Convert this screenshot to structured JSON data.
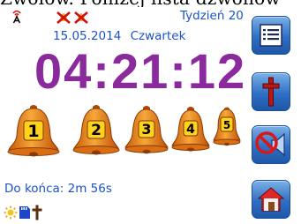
{
  "top_caption": "Zwołów. Poniżej lista dzwonów",
  "status": {
    "antenna_icon": "antenna-icon",
    "muted_indicators": [
      "muted-bell-icon",
      "muted-bell-icon"
    ],
    "week": "Tydzień 20",
    "date": "15.05.2014",
    "weekday": "Czwartek"
  },
  "clock": {
    "time": "04:21:12"
  },
  "bells": [
    {
      "number": "1",
      "icon": "bell-icon"
    },
    {
      "number": "2",
      "icon": "bell-icon"
    },
    {
      "number": "3",
      "icon": "bell-icon"
    },
    {
      "number": "4",
      "icon": "bell-icon"
    },
    {
      "number": "5",
      "icon": "bell-icon"
    }
  ],
  "countdown": "Do końca: 2m 56s",
  "bottom_status_icons": [
    "sun-icon",
    "sd-card-icon",
    "cross-icon"
  ],
  "side_buttons": [
    {
      "name": "list-button",
      "icon": "list-icon"
    },
    {
      "name": "cross-button",
      "icon": "cross-icon"
    },
    {
      "name": "mute-button",
      "icon": "mute-speaker-icon"
    },
    {
      "name": "home-button",
      "icon": "home-icon"
    }
  ],
  "colors": {
    "text_blue": "#1a53c8",
    "clock_purple": "#8a2a9c",
    "bell_orange": "#f08a1a",
    "button_blue": "#2f6fc4",
    "cross_red": "#b81818"
  }
}
